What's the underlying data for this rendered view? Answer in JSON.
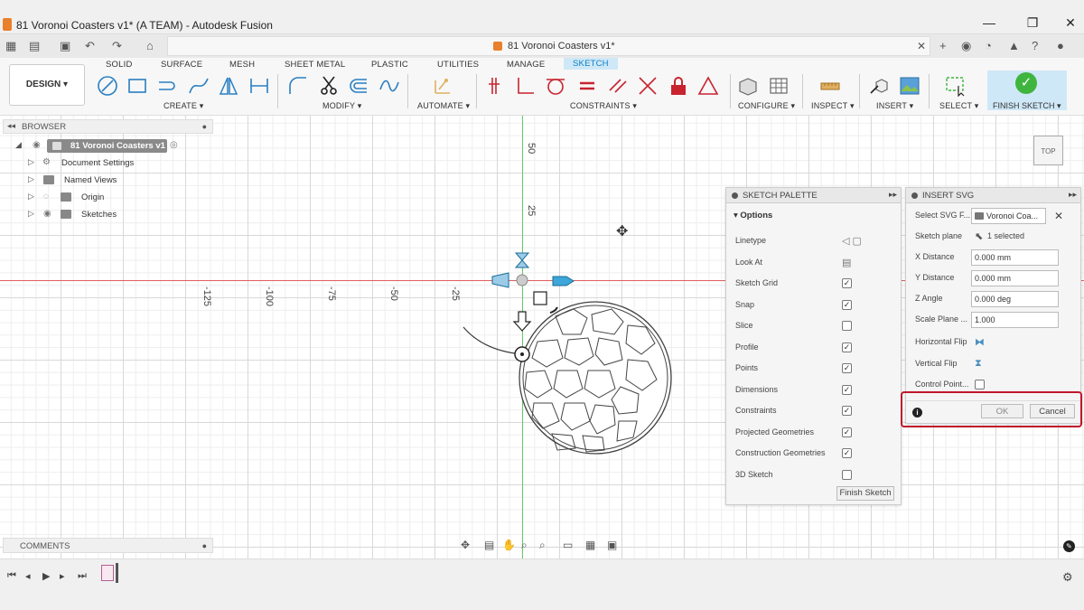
{
  "window": {
    "title": "81 Voronoi Coasters v1* (A TEAM) - Autodesk Fusion",
    "minimize": "—",
    "maximize": "❐",
    "close": "✕"
  },
  "document": {
    "tab_title": "81 Voronoi Coasters v1*",
    "close": "✕"
  },
  "ribbon": {
    "workspace": "DESIGN ▾",
    "tabs": [
      "SOLID",
      "SURFACE",
      "MESH",
      "SHEET METAL",
      "PLASTIC",
      "UTILITIES",
      "MANAGE",
      "SKETCH"
    ],
    "active_tab": "SKETCH",
    "groups": {
      "create": "CREATE ▾",
      "modify": "MODIFY ▾",
      "automate": "AUTOMATE ▾",
      "constraints": "CONSTRAINTS ▾",
      "configure": "CONFIGURE ▾",
      "inspect": "INSPECT ▾",
      "insert": "INSERT ▾",
      "select": "SELECT ▾",
      "finish": "FINISH SKETCH ▾"
    }
  },
  "browser": {
    "title": "BROWSER",
    "root": "81 Voronoi Coasters v1",
    "items": [
      "Document Settings",
      "Named Views",
      "Origin",
      "Sketches"
    ]
  },
  "comments": {
    "title": "COMMENTS"
  },
  "axis": {
    "x_ticks": [
      "-125",
      "-100",
      "-75",
      "-50",
      "-25"
    ],
    "y_ticks": [
      "50",
      "25"
    ]
  },
  "viewcube": {
    "label": "TOP"
  },
  "sketch_palette": {
    "title": "SKETCH PALETTE",
    "section": "Options",
    "rows": [
      {
        "label": "Linetype",
        "kind": "icon"
      },
      {
        "label": "Look At",
        "kind": "icon"
      },
      {
        "label": "Sketch Grid",
        "kind": "check",
        "checked": true
      },
      {
        "label": "Snap",
        "kind": "check",
        "checked": true
      },
      {
        "label": "Slice",
        "kind": "check",
        "checked": false
      },
      {
        "label": "Profile",
        "kind": "check",
        "checked": true
      },
      {
        "label": "Points",
        "kind": "check",
        "checked": true
      },
      {
        "label": "Dimensions",
        "kind": "check",
        "checked": true
      },
      {
        "label": "Constraints",
        "kind": "check",
        "checked": true
      },
      {
        "label": "Projected Geometries",
        "kind": "check",
        "checked": true
      },
      {
        "label": "Construction Geometries",
        "kind": "check",
        "checked": true
      },
      {
        "label": "3D Sketch",
        "kind": "check",
        "checked": false
      }
    ],
    "finish_button": "Finish Sketch"
  },
  "insert_svg": {
    "title": "INSERT SVG",
    "select_svg_label": "Select SVG F...",
    "select_svg_value": "Voronoi Coa...",
    "sketch_plane_label": "Sketch plane",
    "sketch_plane_value": "1 selected",
    "x_distance_label": "X Distance",
    "x_distance_value": "0.000 mm",
    "y_distance_label": "Y Distance",
    "y_distance_value": "0.000 mm",
    "z_angle_label": "Z Angle",
    "z_angle_value": "0.000 deg",
    "scale_label": "Scale Plane ...",
    "scale_value": "1.000",
    "hflip_label": "Horizontal Flip",
    "vflip_label": "Vertical Flip",
    "control_point_label": "Control Point...",
    "ok": "OK",
    "cancel": "Cancel"
  },
  "colors": {
    "accent": "#0c7fc7",
    "highlight": "#c0172a",
    "x_axis": "#e06060",
    "y_axis": "#66cc66",
    "finish_green": "#3fb53f"
  }
}
